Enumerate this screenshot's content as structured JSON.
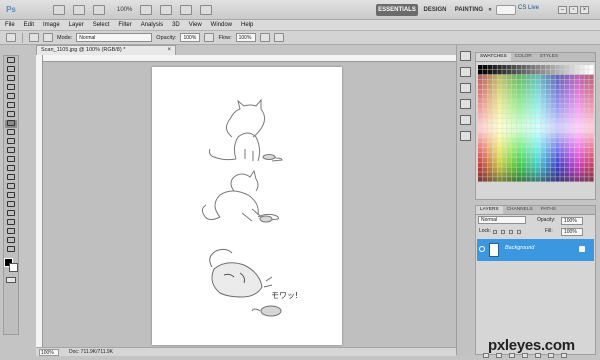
{
  "app": {
    "logo": "Ps",
    "zoom": "100%",
    "workspaces": [
      "ESSENTIALS",
      "DESIGN",
      "PAINTING",
      "»"
    ],
    "cs_live": "CS Live"
  },
  "menu": [
    "File",
    "Edit",
    "Image",
    "Layer",
    "Select",
    "Filter",
    "Analysis",
    "3D",
    "View",
    "Window",
    "Help"
  ],
  "options": {
    "mode_label": "Mode:",
    "mode_value": "Normal",
    "opacity_label": "Opacity:",
    "opacity_value": "100%",
    "flow_label": "Flow:",
    "flow_value": "100%"
  },
  "document": {
    "tab": "Scan_1105.jpg @ 100% (RGB/8) *",
    "close": "×",
    "zoom": "100%",
    "doc_info": "Doc: 711.9K/711.9K",
    "sketch_text": "モワッ!"
  },
  "swatches": {
    "tabs": [
      "SWATCHES",
      "COLOR",
      "STYLES"
    ]
  },
  "layers": {
    "tabs": [
      "LAYERS",
      "CHANNELS",
      "PATHS"
    ],
    "blend": "Normal",
    "opacity_label": "Opacity:",
    "opacity_value": "100%",
    "lock_label": "Lock:",
    "fill_label": "Fill:",
    "fill_value": "100%",
    "layer_name": "Background"
  },
  "watermark": "pxleyes.com",
  "icons": [
    "search-icon",
    "brush-icon",
    "eye-icon",
    "lock-icon",
    "close-icon",
    "minimize-icon",
    "maximize-icon"
  ]
}
